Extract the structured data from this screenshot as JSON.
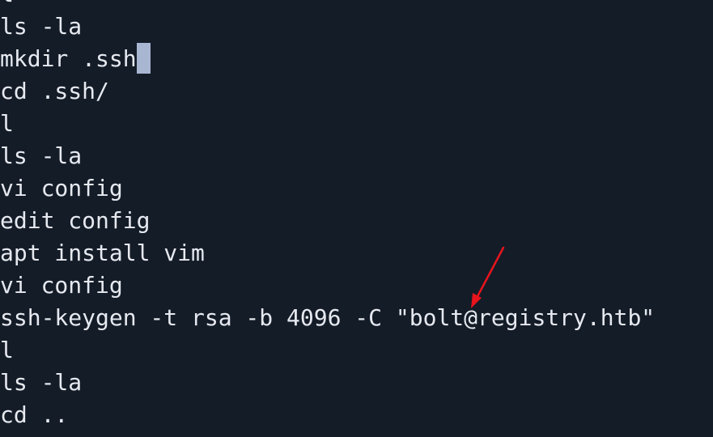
{
  "terminal": {
    "background": "#141c28",
    "text_color": "#e6e9ef",
    "cursor_color": "#a9b6d2",
    "annotation_color": "#e8141c",
    "history": [
      "l",
      "ls -la",
      "mkdir .ssh",
      "cd .ssh/",
      "l",
      "ls -la",
      "vi config",
      "edit config",
      "apt install vim",
      "vi config",
      "ssh-keygen -t rsa -b 4096 -C \"bolt@registry.htb\"",
      "l",
      "ls -la",
      "cd .."
    ]
  }
}
